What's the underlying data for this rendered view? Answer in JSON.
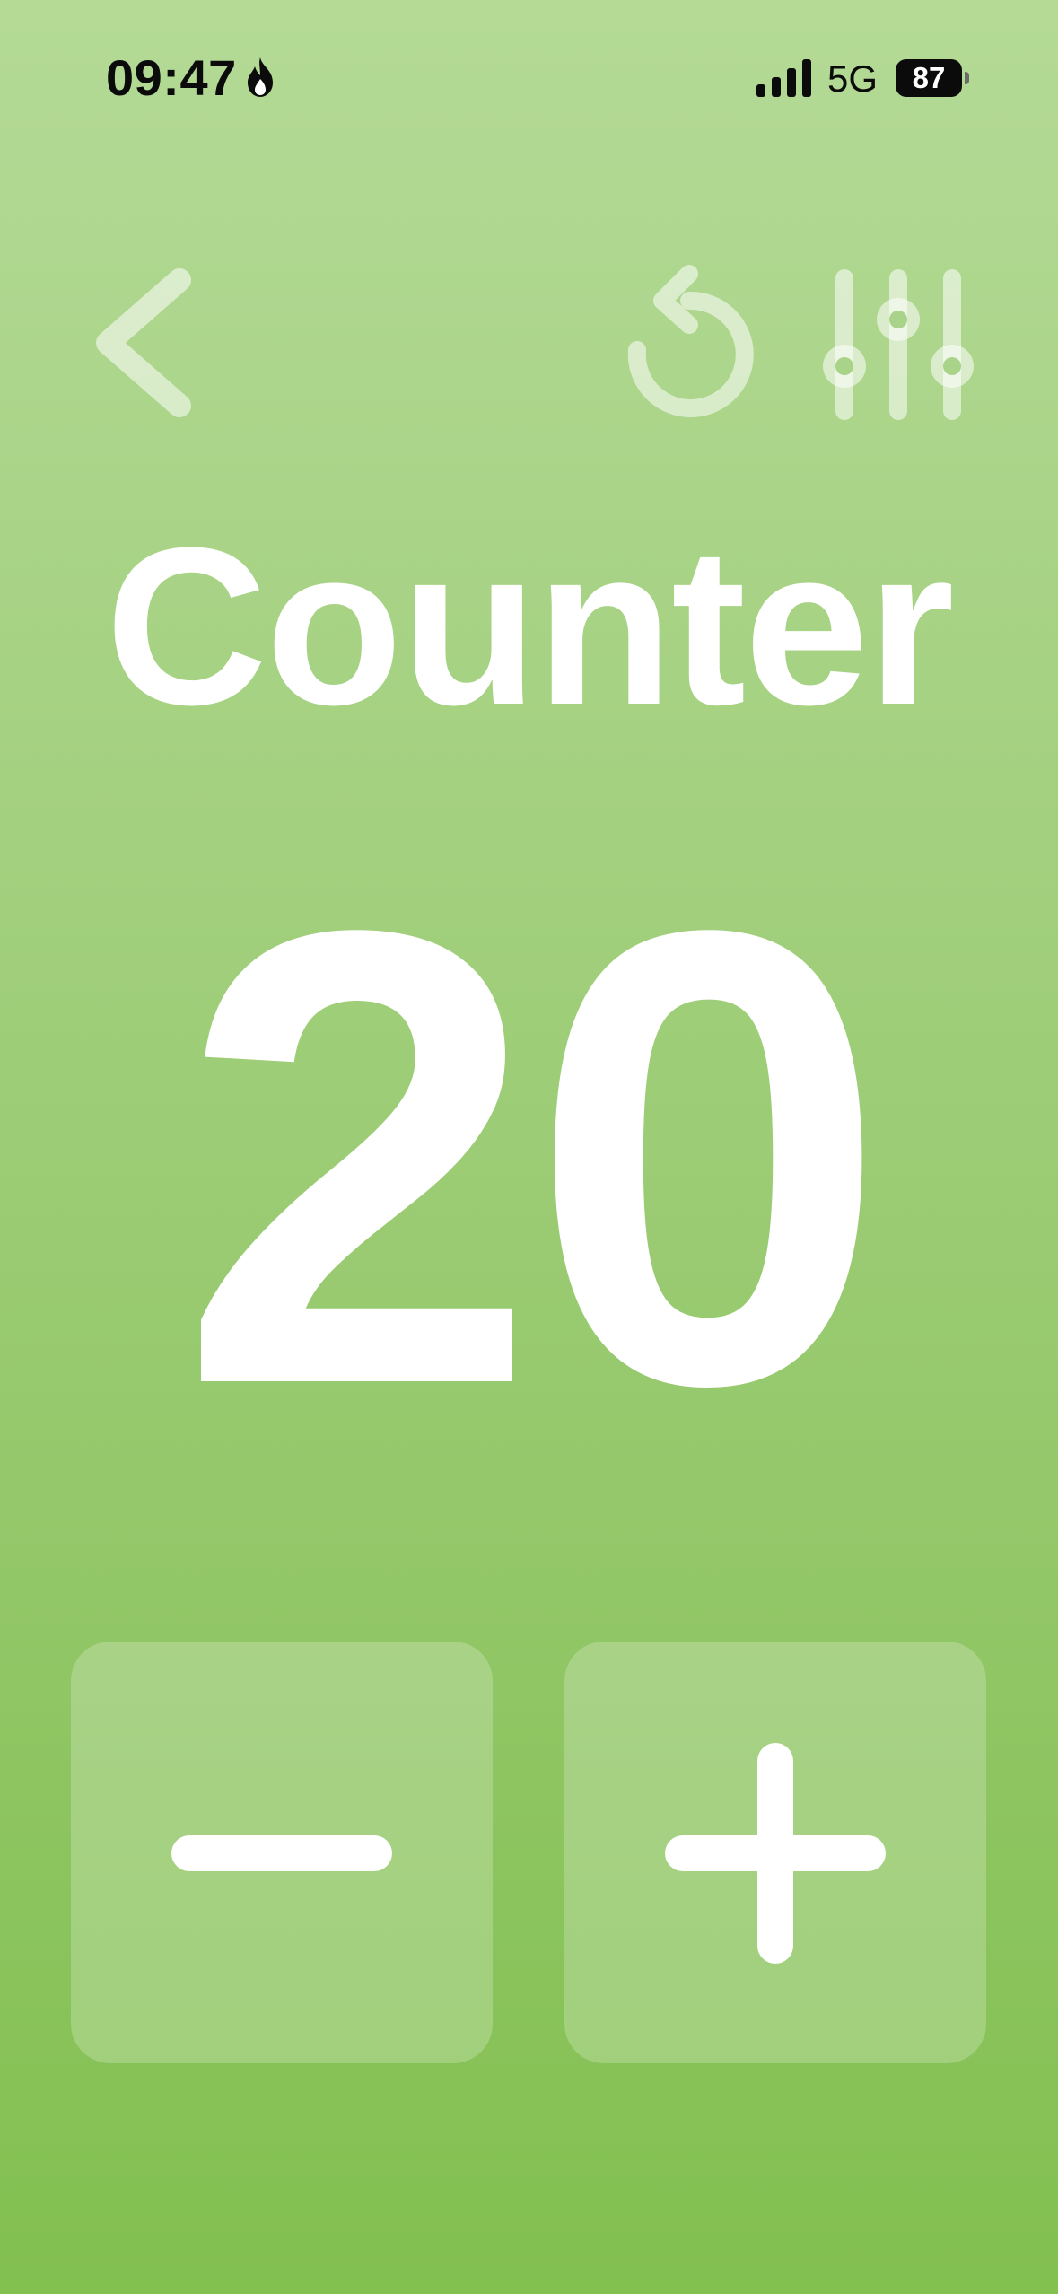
{
  "status_bar": {
    "time": "09:47",
    "network": "5G",
    "battery": "87",
    "icons": [
      "flame-icon",
      "signal-icon",
      "battery-icon"
    ]
  },
  "toolbar": {
    "icons": [
      "chevron-left-icon",
      "reset-icon",
      "sliders-icon"
    ]
  },
  "title": "Counter",
  "counter": {
    "value": "20"
  },
  "controls": {
    "decrement_icon": "minus-icon",
    "increment_icon": "plus-icon"
  },
  "colors": {
    "background_top": "#b4da96",
    "background_bottom": "#82c050",
    "foreground": "#ffffff",
    "button_fill": "rgba(255,255,255,0.22)"
  }
}
